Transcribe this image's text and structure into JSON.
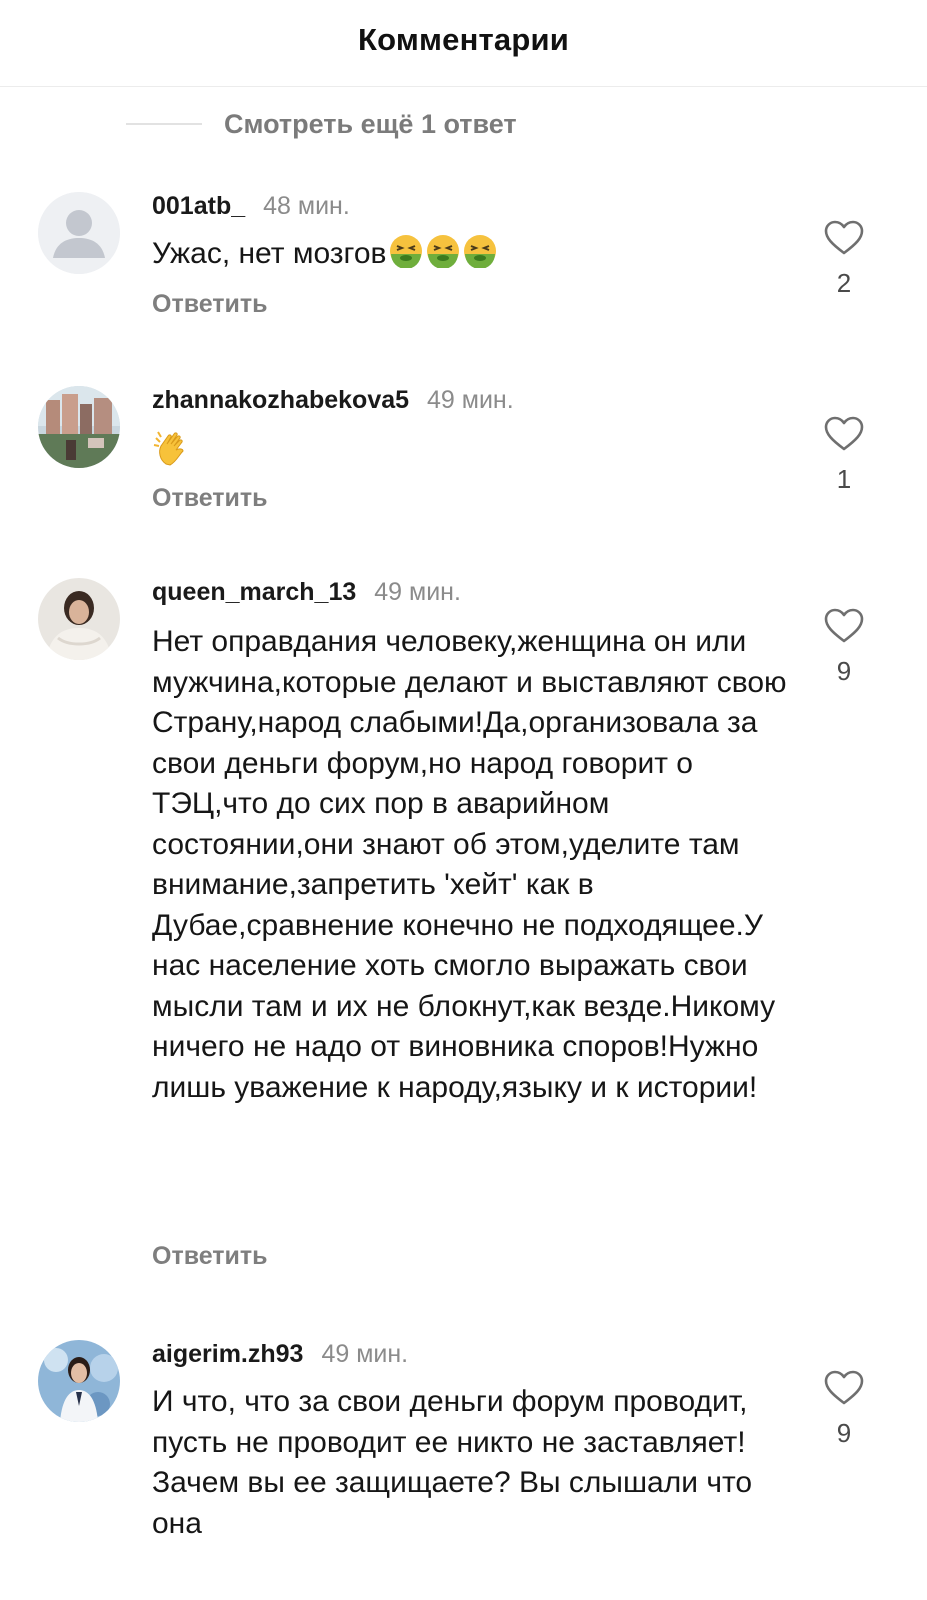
{
  "header": {
    "title": "Комментарии"
  },
  "more_replies": {
    "label": "Смотреть ещё 1 ответ"
  },
  "comments": [
    {
      "username": "001atb_",
      "time": "48 мин.",
      "text": "Ужас, нет мозгов",
      "emoji": [
        "nauseated-face",
        "nauseated-face",
        "nauseated-face"
      ],
      "likes": "2",
      "reply_label": "Ответить"
    },
    {
      "username": "zhannakozhabekova5",
      "time": "49 мин.",
      "text": "",
      "emoji": [
        "clapping-hands"
      ],
      "likes": "1",
      "reply_label": "Ответить"
    },
    {
      "username": "queen_march_13",
      "time": "49 мин.",
      "text": "Нет оправдания человеку,женщина он или мужчина,которые делают и выставляют свою Страну,народ слабыми!Да,организовала за свои деньги форум,но народ говорит о ТЭЦ,что до сих пор в аварийном состоянии,они знают об этом,уделите там внимание,запретить 'хейт' как в Дубае,сравнение конечно не подходящее.У нас население хоть смогло выражать свои мысли там и их не блокнут,как везде.Никому ничего не надо от виновника споров!Нужно лишь уважение к народу,языку и к истории!",
      "likes": "9",
      "reply_label": "Ответить"
    },
    {
      "username": "aigerim.zh93",
      "time": "49 мин.",
      "text": "И что, что за свои деньги форум проводит, пусть не проводит ее никто не заставляет! Зачем вы ее защищаете? Вы слышали что она",
      "likes": "9"
    }
  ]
}
